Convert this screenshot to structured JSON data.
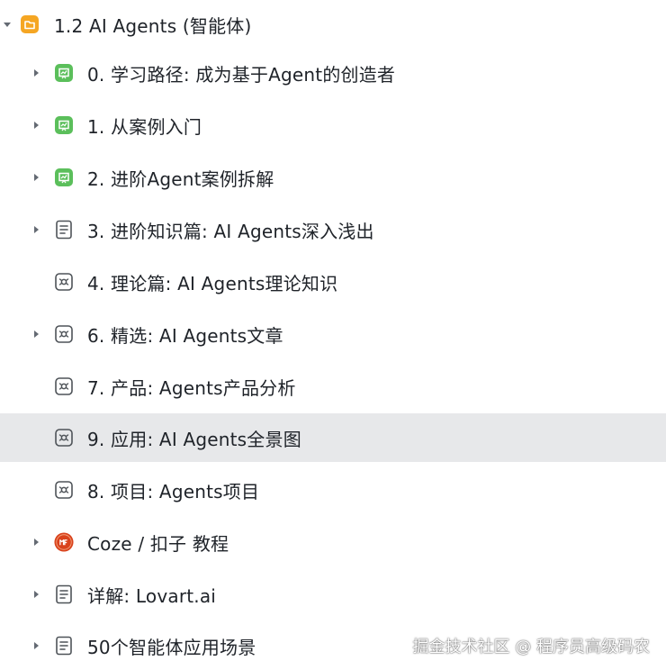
{
  "colors": {
    "folder_orange": "#f5a623",
    "board_green": "#5bbf5b",
    "doc_gray": "#4e5358",
    "coze_red": "#d9421c",
    "selected_bg": "#e7e8ea"
  },
  "root": {
    "label": "1.2 AI Agents (智能体)",
    "icon": "folder-icon",
    "expanded": true
  },
  "items": [
    {
      "label": "0. 学习路径: 成为基于Agent的创造者",
      "icon": "whiteboard-icon",
      "has_children": true
    },
    {
      "label": "1. 从案例入门",
      "icon": "whiteboard-icon",
      "has_children": true
    },
    {
      "label": "2. 进阶Agent案例拆解",
      "icon": "whiteboard-icon",
      "has_children": true
    },
    {
      "label": "3. 进阶知识篇: AI Agents深入浅出",
      "icon": "document-icon",
      "has_children": true
    },
    {
      "label": "4. 理论篇: AI Agents理论知识",
      "icon": "mindmap-icon",
      "has_children": false
    },
    {
      "label": "6. 精选: AI Agents文章",
      "icon": "mindmap-icon",
      "has_children": true
    },
    {
      "label": "7. 产品: Agents产品分析",
      "icon": "mindmap-icon",
      "has_children": false
    },
    {
      "label": "9. 应用: AI Agents全景图",
      "icon": "mindmap-icon",
      "has_children": false,
      "selected": true
    },
    {
      "label": "8. 项目: Agents项目",
      "icon": "mindmap-icon",
      "has_children": false
    },
    {
      "label": "Coze / 扣子 教程",
      "icon": "coze-logo-icon",
      "has_children": true
    },
    {
      "label": "详解: Lovart.ai",
      "icon": "document-icon",
      "has_children": true
    },
    {
      "label": "50个智能体应用场景",
      "icon": "document-icon",
      "has_children": true
    }
  ],
  "watermark": "掘金技术社区 @ 程序员高级码农"
}
